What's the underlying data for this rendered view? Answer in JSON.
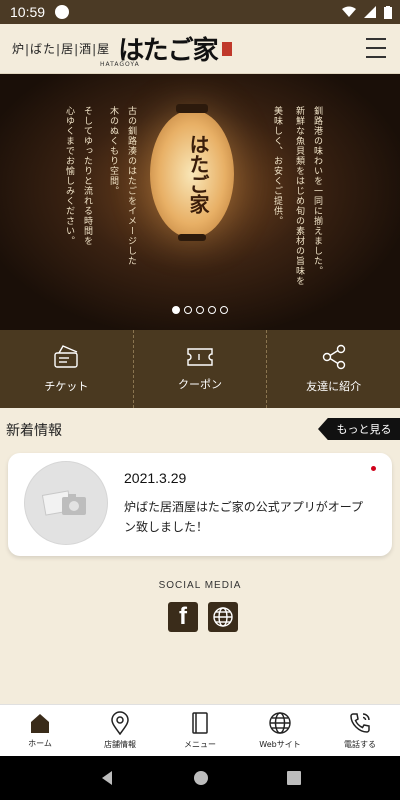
{
  "status_bar": {
    "time": "10:59"
  },
  "header": {
    "logo_small": "炉|ばた|居|酒|屋",
    "logo_main": "はたご家",
    "logo_sub": "HATAGOYA"
  },
  "hero": {
    "text_right_col1": "釧路港の味わいを一同に揃えました。",
    "text_right_col2": "新鮮な魚貝類をはじめ旬の素材の旨味を",
    "text_right_col3": "美味しく、お安くご提供。",
    "text_left_col1": "古の釧路湊のはたごをイメージした",
    "text_left_col2": "木のぬくもり空間。",
    "text_left_col3": "そしてゆったりと流れる時間を",
    "text_left_col4": "心ゆくまでお愉しみください。",
    "lantern_text": "はたご家"
  },
  "carousel": {
    "count": 5,
    "active": 0
  },
  "quick_nav": {
    "ticket": "チケット",
    "coupon": "クーポン",
    "refer": "友達に紹介"
  },
  "news": {
    "title": "新着情報",
    "more": "もっと見る",
    "item": {
      "date": "2021.3.29",
      "body": "炉ばた居酒屋はたご家の公式アプリがオープン致しました！"
    }
  },
  "social": {
    "label": "SOCIAL MEDIA"
  },
  "tabs": {
    "home": "ホーム",
    "store": "店舗情報",
    "menu": "メニュー",
    "web": "Webサイト",
    "phone": "電話する"
  },
  "colors": {
    "status_bar": "#4b3a25",
    "background": "#f3ecdc",
    "quick_nav": "#4a3920",
    "accent_dot": "#d0021b"
  }
}
